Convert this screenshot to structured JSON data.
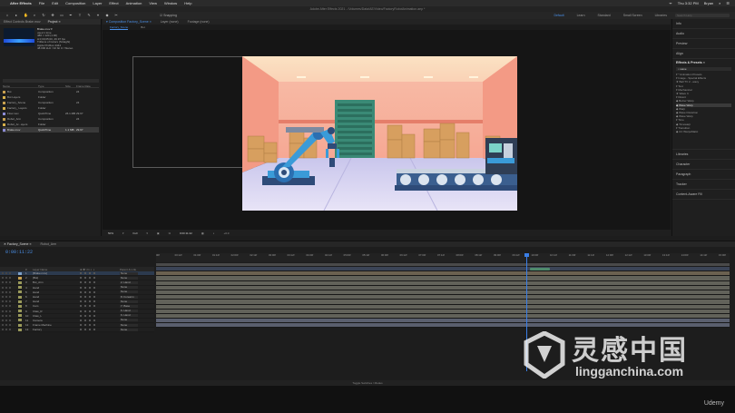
{
  "menubar": {
    "apple": "",
    "items": [
      "After Effects",
      "File",
      "Edit",
      "Composition",
      "Layer",
      "Effect",
      "Animation",
      "View",
      "Window",
      "Help"
    ],
    "status": [
      "ᯤ",
      "Thu 3:32 PM",
      "Bryan",
      "⌕",
      "☰"
    ]
  },
  "titlebar": {
    "title": "Adobe After Effects 2021 - /Volumes/Data/AE/Video/FactoryRobotAnimation.aep *"
  },
  "toolbar": {
    "tools": [
      "⌂",
      "▸",
      "✋",
      "⌕",
      "↻",
      "✥",
      "▭",
      "✒",
      "T",
      "✎",
      "⌖",
      "◆",
      "✂"
    ],
    "snapping": "☑ Snapping",
    "workspaces": [
      {
        "label": "Default",
        "active": true
      },
      {
        "label": "Learn",
        "active": false
      },
      {
        "label": "Standard",
        "active": false
      },
      {
        "label": "Small Screen",
        "active": false
      },
      {
        "label": "Libraries",
        "active": false
      }
    ],
    "search_placeholder": "Search Help"
  },
  "project": {
    "tabs": [
      "Effect Controls Brake.mov",
      "Project ≡"
    ],
    "info": {
      "name": "Brake.mov ▾",
      "lines": [
        "used 1 time",
        "486 × 120 (1.00)",
        "Δ 0;00;05;00, 29.97 fps",
        "Trillions of Colors (Straight)",
        "Apple ProRes 4444",
        "48.000 kHz / 32 bit U / Stereo"
      ]
    },
    "columns": [
      "Name",
      "Type",
      "Size",
      "Frame Rate"
    ],
    "items": [
      {
        "name": "Bot",
        "type": "Composition",
        "size": "",
        "fps": "24",
        "color": "#c8a050",
        "sel": false
      },
      {
        "name": "Bot Layers",
        "type": "Folder",
        "size": "",
        "fps": "",
        "color": "#d7b04a",
        "sel": false
      },
      {
        "name": "Factory_Scene",
        "type": "Composition",
        "size": "",
        "fps": "24",
        "color": "#c8a050",
        "sel": false
      },
      {
        "name": "Factory_ Layers",
        "type": "Folder",
        "size": "",
        "fps": "",
        "color": "#d7b04a",
        "sel": false
      },
      {
        "name": "Flow.mov",
        "type": "QuickTime",
        "size": "26.1 MB",
        "fps": "29.97",
        "color": "#8c8cd6",
        "sel": false
      },
      {
        "name": "Robot_Arm",
        "type": "Composition",
        "size": "",
        "fps": "24",
        "color": "#c8a050",
        "sel": false
      },
      {
        "name": "Robot_Ar...ayers",
        "type": "Folder",
        "size": "",
        "fps": "",
        "color": "#d7b04a",
        "sel": false
      },
      {
        "name": "Brake.mov",
        "type": "QuickTime",
        "size": "1.1 MB",
        "fps": "29.97",
        "color": "#8c8cd6",
        "sel": true
      }
    ]
  },
  "comp": {
    "tabs": [
      {
        "label": "▾ Composition Factory_Scene ≡",
        "active": true
      },
      {
        "label": "Layer (none)",
        "active": false
      },
      {
        "label": "Footage (none)",
        "active": false
      }
    ],
    "breadcrumbs": [
      {
        "label": "Factory_Scene",
        "active": true
      },
      {
        "label": "Bot",
        "active": false
      }
    ],
    "footer": [
      "50%",
      "▾",
      "Full",
      "▾",
      "▣",
      "⧉",
      "0:00:11:22",
      "▦",
      "◐",
      "+0.0"
    ]
  },
  "right_panel": {
    "top_items": [
      "Info",
      "Audio",
      "Preview",
      "Align"
    ],
    "effects_title": "Effects & Presets ≡",
    "effects_search": "⌕ wave",
    "effects_tree": [
      {
        "label": "▾ * Animation Presets",
        "sel": false
      },
      {
        "label": "  ▾ Image - Special Effects",
        "sel": false
      },
      {
        "label": "      ★ Ball TV 2 - wavy",
        "sel": false
      },
      {
        "label": "  ▾ Text",
        "sel": false
      },
      {
        "label": "    ▾ Mechanical",
        "sel": false
      },
      {
        "label": "      ★ Wave It",
        "sel": false
      },
      {
        "label": "▾ Distort",
        "sel": false
      },
      {
        "label": "    ◆ Bezier Warp",
        "sel": false
      },
      {
        "label": "    ◆ Wave Warp",
        "sel": true
      },
      {
        "label": "    ◆ Warp",
        "sel": false
      },
      {
        "label": "    ◆ Wave Distortion",
        "sel": false
      },
      {
        "label": "    ◆ Wave Warp",
        "sel": false
      },
      {
        "label": "▾ Time",
        "sel": false
      },
      {
        "label": "    ◆ Timewarp",
        "sel": false
      },
      {
        "label": "▾ Transition",
        "sel": false
      },
      {
        "label": "    ◆ CC WarpoMatic",
        "sel": false
      }
    ],
    "bottom_items": [
      "Libraries",
      "Character",
      "Paragraph",
      "Tracker",
      "Content-Aware Fill"
    ]
  },
  "timeline": {
    "tabs": [
      {
        "label": "✕ Factory_Scene ≡",
        "active": true
      },
      {
        "label": "Robot_Arm",
        "active": false
      }
    ],
    "timecode": "0:00:11:22",
    "layer_columns": [
      "#",
      "Layer Name",
      "⊕ ✱ \\ fx ◐ ◑",
      "Parent & Link"
    ],
    "layers": [
      {
        "num": "1",
        "name": "[Brake.mov]",
        "parent": "None",
        "sel": true,
        "color": "#7da0c8"
      },
      {
        "num": "2",
        "name": "[Bot]",
        "parent": "None",
        "sel": false,
        "color": "#c8a050"
      },
      {
        "num": "3",
        "name": "Bot_Arm",
        "parent": "2. Hand",
        "sel": false,
        "color": "#9a9a5a"
      },
      {
        "num": "4",
        "name": "Hand",
        "parent": "None",
        "sel": false,
        "color": "#9a9a5a"
      },
      {
        "num": "5",
        "name": "Hand",
        "parent": "None",
        "sel": false,
        "color": "#9a9a5a"
      },
      {
        "num": "6",
        "name": "Hand",
        "parent": "8. Forearm",
        "sel": false,
        "color": "#9a9a5a"
      },
      {
        "num": "7",
        "name": "Hand",
        "parent": "None",
        "sel": false,
        "color": "#9a9a5a"
      },
      {
        "num": "8",
        "name": "Cam",
        "parent": "7. Base",
        "sel": false,
        "color": "#9a9a5a"
      },
      {
        "num": "9",
        "name": "Claw_R",
        "parent": "6. Hand",
        "sel": false,
        "color": "#9a9a5a"
      },
      {
        "num": "10",
        "name": "Claw_L",
        "parent": "6. Hand",
        "sel": false,
        "color": "#9a9a5a"
      },
      {
        "num": "11",
        "name": "Camera",
        "parent": "None",
        "sel": false,
        "color": "#9a9a5a"
      },
      {
        "num": "12",
        "name": "Frame Machine",
        "parent": "None",
        "sel": false,
        "color": "#9a9a5a"
      },
      {
        "num": "13",
        "name": "Factory",
        "parent": "None",
        "sel": false,
        "color": "#9a9a5a"
      }
    ],
    "ruler_ticks": [
      "00f",
      "00:12f",
      "01:00f",
      "01:12f",
      "02:00f",
      "02:12f",
      "03:00f",
      "03:12f",
      "04:00f",
      "04:12f",
      "05:00f",
      "05:12f",
      "06:00f",
      "06:12f",
      "07:00f",
      "07:12f",
      "08:00f",
      "08:12f",
      "09:00f",
      "09:12f",
      "10:00f",
      "10:12f",
      "11:00f",
      "11:12f",
      "12:00f",
      "12:12f",
      "13:00f",
      "13:12f",
      "14:00f",
      "14:12f",
      "15:00f"
    ],
    "playhead_fraction": 0.645,
    "footer": "Toggle Switches / Modes"
  },
  "watermark": {
    "cn": "灵感中国",
    "en": "lingganchina.com"
  },
  "udemy": "Udemy",
  "colors": {
    "accent": "#4a8fe7",
    "track_video": "#5a5f6e",
    "track_comp": "#6b6150",
    "track_bar_green": "#4f8a6c"
  }
}
